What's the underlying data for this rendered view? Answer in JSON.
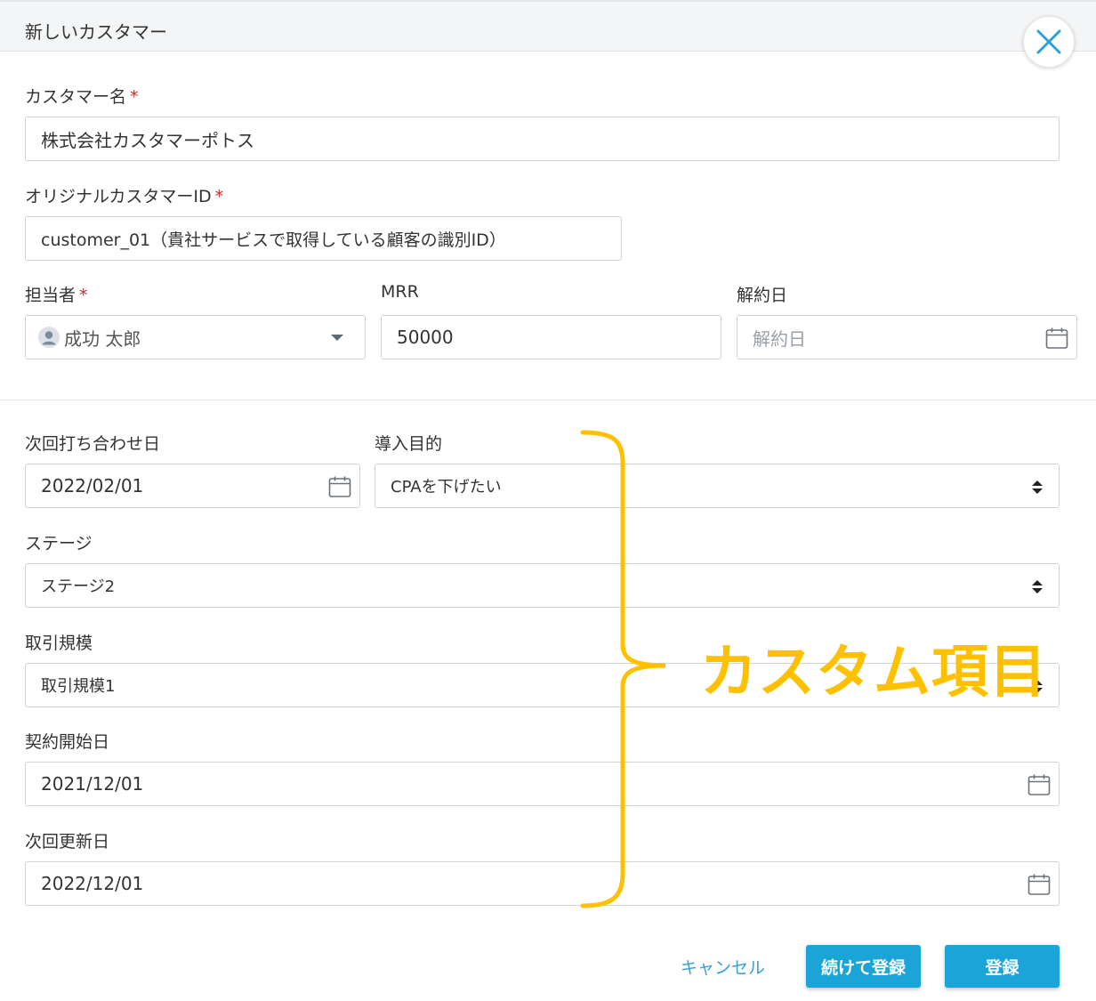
{
  "dialog": {
    "title": "新しいカスタマー"
  },
  "icons": {
    "close": "close-icon",
    "calendar": "calendar-icon",
    "user": "user-avatar-icon",
    "dropdown": "chevron-down-icon",
    "spinner": "up-down-arrows-icon"
  },
  "colors": {
    "accent": "#1aa4d8",
    "link": "#3aa0d4",
    "required": "#c62828",
    "annotation": "#ffc000",
    "close_icon": "#2f9fd8"
  },
  "form": {
    "customer_name": {
      "label": "カスタマー名",
      "required_mark": "*",
      "value": "株式会社カスタマーポトス"
    },
    "original_id": {
      "label": "オリジナルカスタマーID",
      "required_mark": "*",
      "value": "customer_01（貴社サービスで取得している顧客の識別ID）"
    },
    "owner": {
      "label": "担当者",
      "required_mark": "*",
      "value": "成功 太郎"
    },
    "mrr": {
      "label": "MRR",
      "value": "50000"
    },
    "cancel_date": {
      "label": "解約日",
      "placeholder": "解約日"
    }
  },
  "custom_fields": {
    "next_meeting": {
      "label": "次回打ち合わせ日",
      "value": "2022/02/01"
    },
    "purpose": {
      "label": "導入目的",
      "value": "CPAを下げたい"
    },
    "stage": {
      "label": "ステージ",
      "value": "ステージ2"
    },
    "deal_size": {
      "label": "取引規模",
      "value": "取引規模1"
    },
    "contract_start": {
      "label": "契約開始日",
      "value": "2021/12/01"
    },
    "next_renewal": {
      "label": "次回更新日",
      "value": "2022/12/01"
    }
  },
  "annotation": {
    "text": "カスタム項目"
  },
  "footer": {
    "cancel_label": "キャンセル",
    "save_continue_label": "続けて登録",
    "save_label": "登録"
  }
}
